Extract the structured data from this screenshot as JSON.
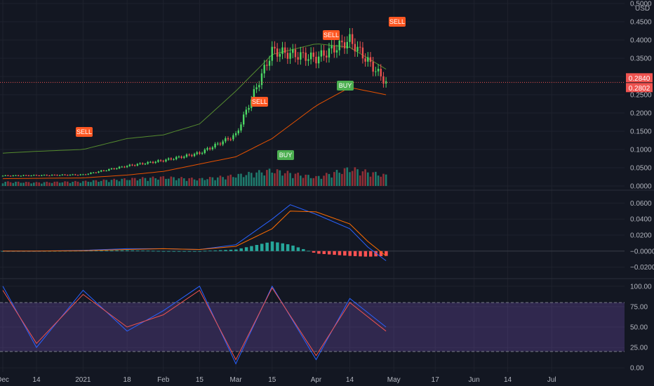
{
  "currency": "USD",
  "colors": {
    "background": "#131722",
    "up": "#26a69a",
    "down": "#ef5350",
    "macd_line": "#2962ff",
    "signal_line": "#ff6d00",
    "stoch_k": "#2962ff",
    "stoch_d": "#ef5350",
    "stoch_band": "#7e57c2",
    "sell": "#ff5722",
    "buy": "#4caf50",
    "triangle_up": "#9e9d24",
    "triangle_down": "#c2185b",
    "price_line": "#ef5350"
  },
  "price_tags": [
    {
      "label": "0.2840",
      "value": 0.284
    },
    {
      "label": "0.2802",
      "value": 0.2802
    }
  ],
  "signals": [
    {
      "label": "SELL",
      "type": "sell"
    },
    {
      "label": "SELL",
      "type": "sell"
    },
    {
      "label": "SELL",
      "type": "sell"
    },
    {
      "label": "SELL",
      "type": "sell"
    },
    {
      "label": "BUY",
      "type": "buy"
    },
    {
      "label": "BUY",
      "type": "buy"
    }
  ],
  "chart_data": [
    {
      "type": "candlestick",
      "panel": "price",
      "ylim": [
        0.0,
        0.5
      ],
      "y_ticks": [
        "0.0000",
        "0.0500",
        "0.1000",
        "0.1500",
        "0.2000",
        "0.2500",
        "0.3000",
        "0.3500",
        "0.4000",
        "0.4500",
        "0.5000"
      ],
      "x_ticks": [
        "Dec",
        "14",
        "2021",
        "18",
        "Feb",
        "15",
        "Mar",
        "15",
        "Apr",
        "14",
        "May",
        "17",
        "Jun",
        "14",
        "Jul"
      ],
      "x": [
        "Dec 1",
        "Dec 14",
        "Jan 1",
        "Jan 18",
        "Feb 1",
        "Feb 15",
        "Mar 1",
        "Mar 15",
        "Apr 1",
        "Apr 14",
        "Apr 28"
      ],
      "close": [
        0.028,
        0.029,
        0.031,
        0.055,
        0.07,
        0.09,
        0.14,
        0.37,
        0.35,
        0.4,
        0.284
      ],
      "last_price": 0.284,
      "series": [
        {
          "name": "Upper band",
          "values": [
            0.09,
            0.095,
            0.1,
            0.13,
            0.14,
            0.17,
            0.26,
            0.36,
            0.39,
            0.38,
            0.32
          ]
        },
        {
          "name": "Lower band",
          "values": [
            0.02,
            0.021,
            0.022,
            0.03,
            0.04,
            0.06,
            0.08,
            0.13,
            0.22,
            0.27,
            0.25
          ]
        }
      ],
      "volume": [
        0.012,
        0.01,
        0.013,
        0.02,
        0.025,
        0.02,
        0.03,
        0.045,
        0.025,
        0.05,
        0.03
      ]
    },
    {
      "type": "line",
      "panel": "macd",
      "ylim": [
        -0.03,
        0.07
      ],
      "y_ticks": [
        "−0.0200",
        "−0.0000",
        "0.0200",
        "0.0400",
        "0.0600"
      ],
      "x": [
        "Dec 1",
        "Dec 14",
        "Jan 1",
        "Jan 18",
        "Feb 1",
        "Feb 15",
        "Mar 1",
        "Mar 15",
        "Mar 22",
        "Apr 1",
        "Apr 14",
        "Apr 21",
        "Apr 28"
      ],
      "series": [
        {
          "name": "MACD",
          "values": [
            0.0,
            0.0,
            0.001,
            0.003,
            0.003,
            0.002,
            0.008,
            0.04,
            0.058,
            0.046,
            0.028,
            0.005,
            -0.012
          ]
        },
        {
          "name": "Signal",
          "values": [
            0.0,
            0.0,
            0.0005,
            0.002,
            0.003,
            0.002,
            0.006,
            0.028,
            0.05,
            0.049,
            0.034,
            0.012,
            -0.006
          ]
        }
      ],
      "histogram": [
        0.0,
        0.0,
        0.0005,
        0.001,
        0.0,
        0.0,
        0.002,
        0.012,
        0.008,
        -0.003,
        -0.006,
        -0.007,
        -0.006
      ]
    },
    {
      "type": "line",
      "panel": "stochastic",
      "ylim": [
        -5,
        105
      ],
      "y_ticks": [
        "0.00",
        "25.00",
        "50.00",
        "75.00",
        "100.00"
      ],
      "band": [
        20,
        80
      ],
      "x": [
        "Dec 1",
        "Dec 14",
        "Jan 1",
        "Jan 18",
        "Feb 1",
        "Feb 15",
        "Mar 1",
        "Mar 15",
        "Apr 1",
        "Apr 14",
        "Apr 28"
      ],
      "series": [
        {
          "name": "%K",
          "values": [
            100,
            25,
            95,
            45,
            70,
            100,
            5,
            100,
            10,
            85,
            50
          ]
        },
        {
          "name": "%D",
          "values": [
            95,
            30,
            90,
            50,
            65,
            95,
            10,
            98,
            15,
            80,
            45
          ]
        }
      ]
    }
  ]
}
